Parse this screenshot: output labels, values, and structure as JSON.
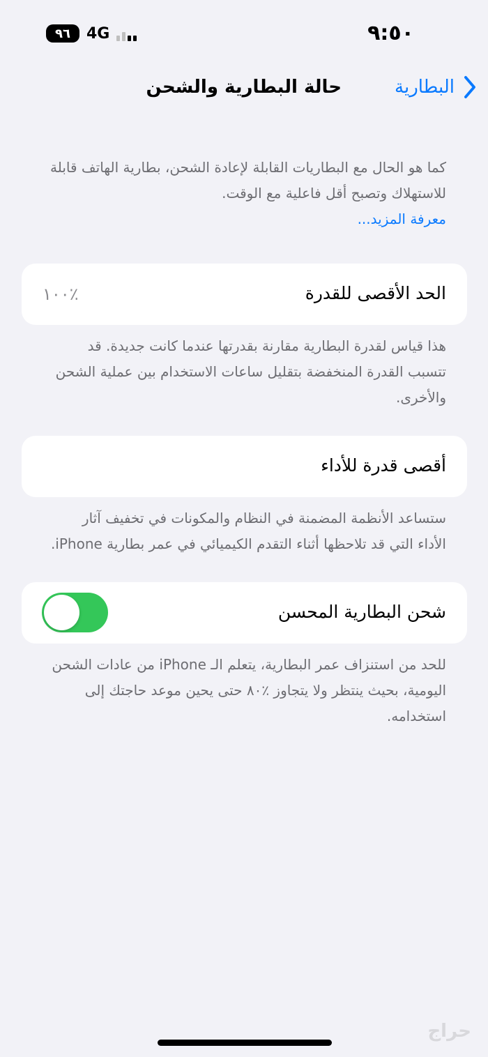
{
  "status_bar": {
    "time": "٩:٥٠",
    "network": "4G",
    "battery_level": "٩٦"
  },
  "nav": {
    "back_label": "البطارية",
    "title": "حالة البطارية والشحن"
  },
  "intro": {
    "text": "كما هو الحال مع البطاريات القابلة لإعادة الشحن، بطارية الهاتف قابلة للاستهلاك وتصبح أقل فاعلية مع الوقت.",
    "learn_more": "معرفة المزيد..."
  },
  "max_capacity": {
    "label": "الحد الأقصى للقدرة",
    "value": "٪١٠٠",
    "footnote": "هذا قياس لقدرة البطارية مقارنة بقدرتها عندما كانت جديدة. قد تتسبب القدرة المنخفضة بتقليل ساعات الاستخدام بين عملية الشحن والأخرى."
  },
  "peak_performance": {
    "label": "أقصى قدرة للأداء",
    "footnote": "ستساعد الأنظمة المضمنة في النظام والمكونات في تخفيف آثار الأداء التي قد تلاحظها أثناء التقدم الكيميائي في عمر بطارية iPhone."
  },
  "optimized_charging": {
    "label": "شحن البطارية المحسن",
    "enabled": true,
    "toggle_color": "#34c759",
    "footnote": "للحد من استنزاف عمر البطارية، يتعلم الـ iPhone من عادات الشحن اليومية، بحيث ينتظر ولا يتجاوز ٪٨٠ حتى يحين موعد حاجتك إلى استخدامه."
  },
  "watermark": "حراج",
  "colors": {
    "accent": "#0a7aff",
    "background": "#f2f2f7",
    "secondary_text": "#6d6d72"
  }
}
